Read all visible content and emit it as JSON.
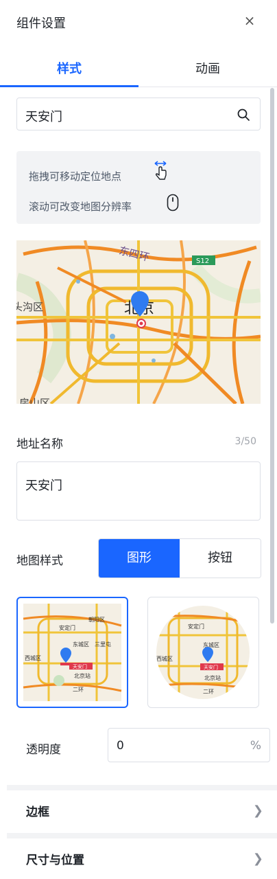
{
  "header": {
    "title": "组件设置",
    "close_label": "×"
  },
  "tabs": [
    {
      "label": "样式",
      "active": true
    },
    {
      "label": "动画",
      "active": false
    }
  ],
  "search": {
    "value": "天安门",
    "icon": "search-icon"
  },
  "tips": [
    {
      "text": "拖拽可移动定位地点",
      "icon": "drag-hand-icon"
    },
    {
      "text": "滚动可改变地图分辨率",
      "icon": "mouse-scroll-icon"
    }
  ],
  "map": {
    "labels": {
      "top_road": "东四环",
      "shield": "S12",
      "city": "北京",
      "west": "头沟区",
      "bottom": "房山区"
    }
  },
  "address": {
    "label": "地址名称",
    "counter": "3/50",
    "value": "天安门"
  },
  "map_style": {
    "label": "地图样式",
    "options": [
      {
        "label": "图形",
        "selected": true
      },
      {
        "label": "按钮",
        "selected": false
      }
    ],
    "thumb_labels": {
      "north": "朝阳区",
      "gate": "安定门",
      "east": "东城区",
      "west": "西城区",
      "third": "三里屯",
      "center": "天安门",
      "station": "北京站",
      "ring": "二环"
    }
  },
  "opacity": {
    "label": "透明度",
    "value": "0",
    "unit": "%"
  },
  "sections": [
    {
      "label": "边框"
    },
    {
      "label": "尺寸与位置"
    }
  ],
  "colors": {
    "accent": "#1a66ff",
    "panel_bg": "#f2f3f5",
    "border": "#dcdfe6"
  }
}
